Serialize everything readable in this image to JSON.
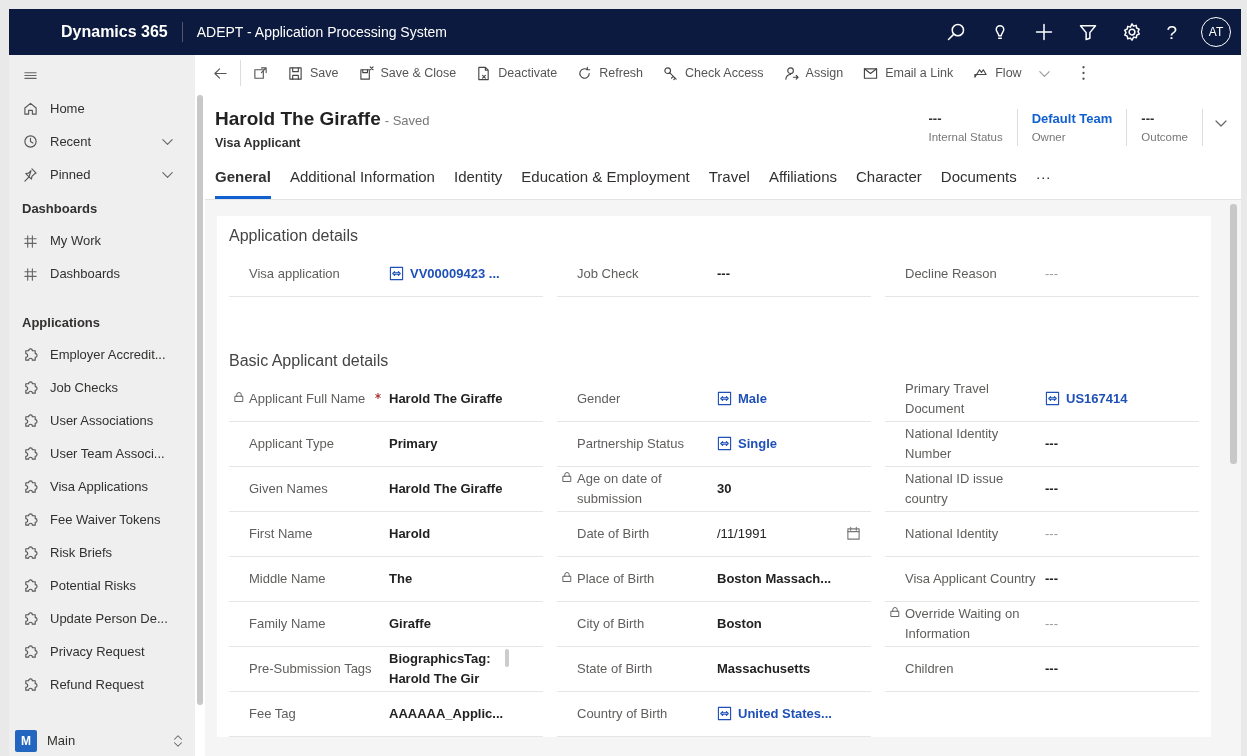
{
  "top_bar": {
    "product": "Dynamics 365",
    "app_name": "ADEPT - Application Processing System",
    "help": "?",
    "avatar": "AT"
  },
  "sidebar": {
    "nav": [
      {
        "label": "Home",
        "expandable": false
      },
      {
        "label": "Recent",
        "expandable": true
      },
      {
        "label": "Pinned",
        "expandable": true
      }
    ],
    "groups": [
      {
        "title": "Dashboards",
        "items": [
          "My Work",
          "Dashboards"
        ]
      },
      {
        "title": "Applications",
        "items": [
          "Employer Accredit...",
          "Job Checks",
          "User Associations",
          "User Team Associ...",
          "Visa Applications",
          "Fee Waiver Tokens",
          "Risk Briefs",
          "Potential Risks",
          "Update Person De...",
          "Privacy Request",
          "Refund Request"
        ]
      }
    ],
    "area": {
      "badge": "M",
      "label": "Main"
    }
  },
  "toolbar": [
    {
      "label": "Save",
      "dropdown": false
    },
    {
      "label": "Save & Close",
      "dropdown": false
    },
    {
      "label": "Deactivate",
      "dropdown": false
    },
    {
      "label": "Refresh",
      "dropdown": false
    },
    {
      "label": "Check Access",
      "dropdown": false
    },
    {
      "label": "Assign",
      "dropdown": false
    },
    {
      "label": "Email a Link",
      "dropdown": false
    },
    {
      "label": "Flow",
      "dropdown": true
    }
  ],
  "record": {
    "title": "Harold The Giraffe",
    "save_state": "- Saved",
    "entity": "Visa Applicant",
    "header_fields": [
      {
        "value": "---",
        "label": "Internal Status",
        "kind": "text"
      },
      {
        "value": "Default Team",
        "label": "Owner",
        "kind": "link"
      },
      {
        "value": "---",
        "label": "Outcome",
        "kind": "text"
      }
    ]
  },
  "tabs": [
    {
      "label": "General",
      "selected": true
    },
    {
      "label": "Additional Information",
      "selected": false
    },
    {
      "label": "Identity",
      "selected": false
    },
    {
      "label": "Education & Employment",
      "selected": false
    },
    {
      "label": "Travel",
      "selected": false
    },
    {
      "label": "Affiliations",
      "selected": false
    },
    {
      "label": "Character",
      "selected": false
    },
    {
      "label": "Documents",
      "selected": false
    }
  ],
  "tabs_more": "···",
  "sections": [
    {
      "title": "Application details",
      "columns": [
        [
          {
            "label": "Visa application",
            "value": "VV00009423 ...",
            "kind": "lookup",
            "locked": false,
            "required": false
          }
        ],
        [
          {
            "label": "Job Check",
            "value": "---",
            "kind": "text",
            "locked": false,
            "required": false
          }
        ],
        [
          {
            "label": "Decline Reason",
            "placeholder": "---",
            "kind": "input",
            "locked": false,
            "required": false
          }
        ]
      ]
    },
    {
      "title": "Basic Applicant details",
      "columns": [
        [
          {
            "label": "Applicant Full Name",
            "value": "Harold The Giraffe",
            "kind": "text",
            "locked": true,
            "required": true
          },
          {
            "label": "Applicant Type",
            "value": "Primary",
            "kind": "text",
            "locked": false,
            "required": false
          },
          {
            "label": "Given Names",
            "value": "Harold The Giraffe",
            "kind": "text",
            "locked": false,
            "required": false
          },
          {
            "label": "First Name",
            "value": "Harold",
            "kind": "text",
            "locked": false,
            "required": false
          },
          {
            "label": "Middle Name",
            "value": "The",
            "kind": "text",
            "locked": false,
            "required": false
          },
          {
            "label": "Family Name",
            "value": "Giraffe",
            "kind": "text",
            "locked": false,
            "required": false
          },
          {
            "label": "Pre-Submission Tags",
            "value": "BiographicsTag: Harold The Gir",
            "kind": "multiline",
            "locked": false,
            "required": false
          },
          {
            "label": "Fee Tag",
            "value": "AAAAAA_Applic...",
            "kind": "text",
            "locked": false,
            "required": false
          }
        ],
        [
          {
            "label": "Gender",
            "value": "Male",
            "kind": "lookup",
            "locked": false,
            "required": false
          },
          {
            "label": "Partnership Status",
            "value": "Single",
            "kind": "lookup",
            "locked": false,
            "required": false
          },
          {
            "label": "Age on date of submission",
            "value": "30",
            "kind": "text",
            "locked": true,
            "required": false
          },
          {
            "label": "Date of Birth",
            "value": "/11/1991",
            "kind": "date",
            "locked": false,
            "required": false
          },
          {
            "label": "Place of Birth",
            "value": "Boston Massach...",
            "kind": "text",
            "locked": true,
            "required": false
          },
          {
            "label": "City of Birth",
            "value": "Boston",
            "kind": "text",
            "locked": false,
            "required": false
          },
          {
            "label": "State of Birth",
            "value": "Massachusetts",
            "kind": "text",
            "locked": false,
            "required": false
          },
          {
            "label": "Country of Birth",
            "value": "United States...",
            "kind": "lookup",
            "locked": false,
            "required": false
          }
        ],
        [
          {
            "label": "Primary Travel Document",
            "value": "US167414",
            "kind": "lookup",
            "locked": false,
            "required": false
          },
          {
            "label": "National Identity Number",
            "value": "---",
            "kind": "text",
            "locked": false,
            "required": false
          },
          {
            "label": "National ID issue country",
            "value": "---",
            "kind": "text",
            "locked": false,
            "required": false
          },
          {
            "label": "National Identity",
            "placeholder": "---",
            "kind": "input",
            "locked": false,
            "required": false
          },
          {
            "label": "Visa Applicant Country",
            "value": "---",
            "kind": "text",
            "locked": false,
            "required": false
          },
          {
            "label": "Override Waiting on Information",
            "placeholder": "---",
            "kind": "input",
            "locked": true,
            "required": false
          },
          {
            "label": "Children",
            "value": "---",
            "kind": "text",
            "locked": false,
            "required": false
          }
        ]
      ]
    }
  ]
}
